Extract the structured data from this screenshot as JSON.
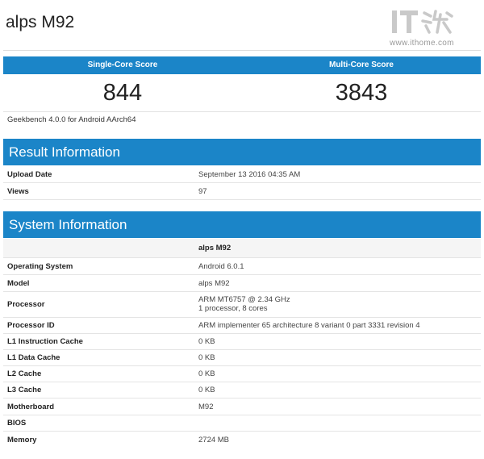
{
  "page": {
    "title": "alps M92"
  },
  "watermark": {
    "brand": "IT之家",
    "url": "www.ithome.com"
  },
  "scores": {
    "single_label": "Single-Core Score",
    "multi_label": "Multi-Core Score",
    "single_value": "844",
    "multi_value": "3843"
  },
  "version": "Geekbench 4.0.0 for Android AArch64",
  "result": {
    "header": "Result Information",
    "rows": [
      {
        "key": "Upload Date",
        "value": "September 13 2016 04:35 AM"
      },
      {
        "key": "Views",
        "value": "97"
      }
    ]
  },
  "system": {
    "header": "System Information",
    "device": "alps M92",
    "rows": [
      {
        "key": "Operating System",
        "value": "Android 6.0.1"
      },
      {
        "key": "Model",
        "value": "alps M92"
      },
      {
        "key": "Processor",
        "value": "ARM MT6757 @ 2.34 GHz",
        "value2": "1 processor, 8 cores"
      },
      {
        "key": "Processor ID",
        "value": "ARM implementer 65 architecture 8 variant 0 part 3331 revision 4"
      },
      {
        "key": "L1 Instruction Cache",
        "value": "0 KB"
      },
      {
        "key": "L1 Data Cache",
        "value": "0 KB"
      },
      {
        "key": "L2 Cache",
        "value": "0 KB"
      },
      {
        "key": "L3 Cache",
        "value": "0 KB"
      },
      {
        "key": "Motherboard",
        "value": "M92"
      },
      {
        "key": "BIOS",
        "value": ""
      },
      {
        "key": "Memory",
        "value": "2724 MB"
      }
    ]
  },
  "colors": {
    "accent": "#1b85c8",
    "border": "#e4e4e4"
  }
}
